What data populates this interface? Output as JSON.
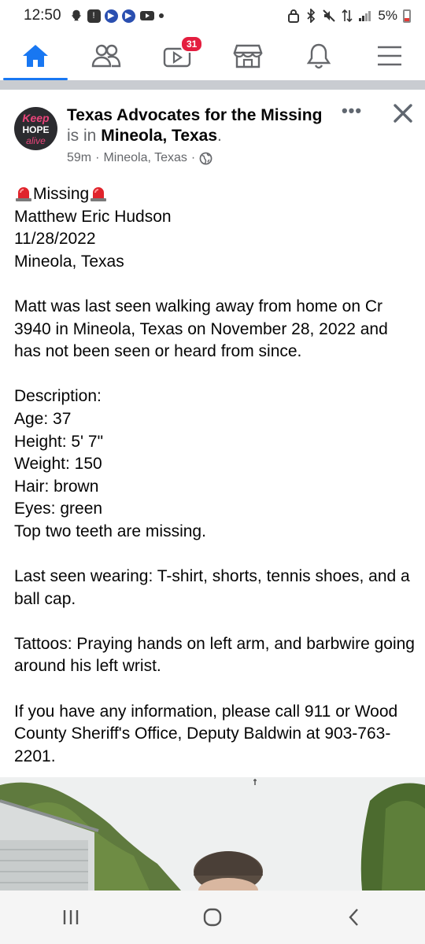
{
  "status_bar": {
    "time": "12:50",
    "battery": "5%"
  },
  "nav": {
    "items": [
      {
        "name": "home",
        "icon": "home-icon",
        "active": true
      },
      {
        "name": "friends",
        "icon": "friends-icon"
      },
      {
        "name": "watch",
        "icon": "video-icon",
        "badge": "31"
      },
      {
        "name": "marketplace",
        "icon": "store-icon"
      },
      {
        "name": "notifications",
        "icon": "bell-icon"
      },
      {
        "name": "menu",
        "icon": "hamburger-icon"
      }
    ],
    "accent_color": "#1877f2",
    "badge_color": "#e41e3f"
  },
  "post": {
    "avatar": {
      "line1": "Keep",
      "line2": "HOPE",
      "line3": "alive"
    },
    "page_name": "Texas Advocates for the Missing",
    "is_in": "is in",
    "location_name": "Mineola, Texas",
    "period": ".",
    "time_ago": "59m",
    "meta_separator": "·",
    "meta_location": "Mineola, Texas",
    "meta_separator2": "·",
    "more_label": "•••",
    "body": {
      "missing_label": "Missing",
      "name": "Matthew Eric Hudson",
      "date": "11/28/2022",
      "city": "Mineola, Texas",
      "paragraph1": "Matt was last seen walking away from home on Cr 3940 in Mineola, Texas on November 28, 2022 and has not been seen or heard from since.",
      "description_label": "Description:",
      "age": "Age: 37",
      "height": "Height: 5' 7\"",
      "weight": "Weight: 150",
      "hair": "Hair: brown",
      "eyes": "Eyes: green",
      "teeth": "Top two teeth are missing.",
      "last_seen": "Last seen wearing: T-shirt, shorts, tennis shoes, and a ball cap.",
      "tattoos": "Tattoos:  Praying hands on left arm, and barbwire going around his left wrist.",
      "info": "If you have any information, please call 911 or Wood County Sheriff's Office, Deputy Baldwin at 903-763-2201."
    }
  },
  "android_nav": {
    "recents_icon": "recents-icon",
    "home_icon": "home-circle-icon",
    "back_icon": "back-icon"
  }
}
